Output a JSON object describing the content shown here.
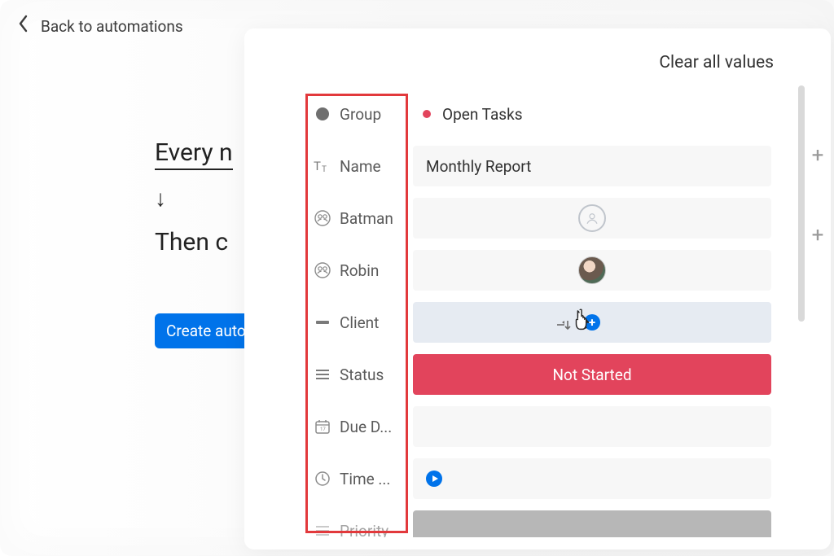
{
  "back": {
    "label": "Back to automations"
  },
  "automation": {
    "trigger_text": "Every n",
    "arrow": "↓",
    "then_text": "Then c",
    "create_label": "Create auto"
  },
  "modal": {
    "clear_all": "Clear all values"
  },
  "fields": {
    "group": {
      "label": "Group",
      "value": "Open Tasks",
      "color": "#e2445c"
    },
    "name": {
      "label": "Name",
      "value": "Monthly Report"
    },
    "person1": {
      "label": "Batman",
      "value": ""
    },
    "person2": {
      "label": "Robin",
      "value": ""
    },
    "client": {
      "label": "Client",
      "value": ""
    },
    "status": {
      "label": "Status",
      "value": "Not Started"
    },
    "due": {
      "label": "Due D...",
      "value": ""
    },
    "time": {
      "label": "Time ...",
      "value": ""
    },
    "priority": {
      "label": "Priority",
      "value": ""
    }
  },
  "icons": {
    "plus": "+",
    "right_plus": "+"
  }
}
